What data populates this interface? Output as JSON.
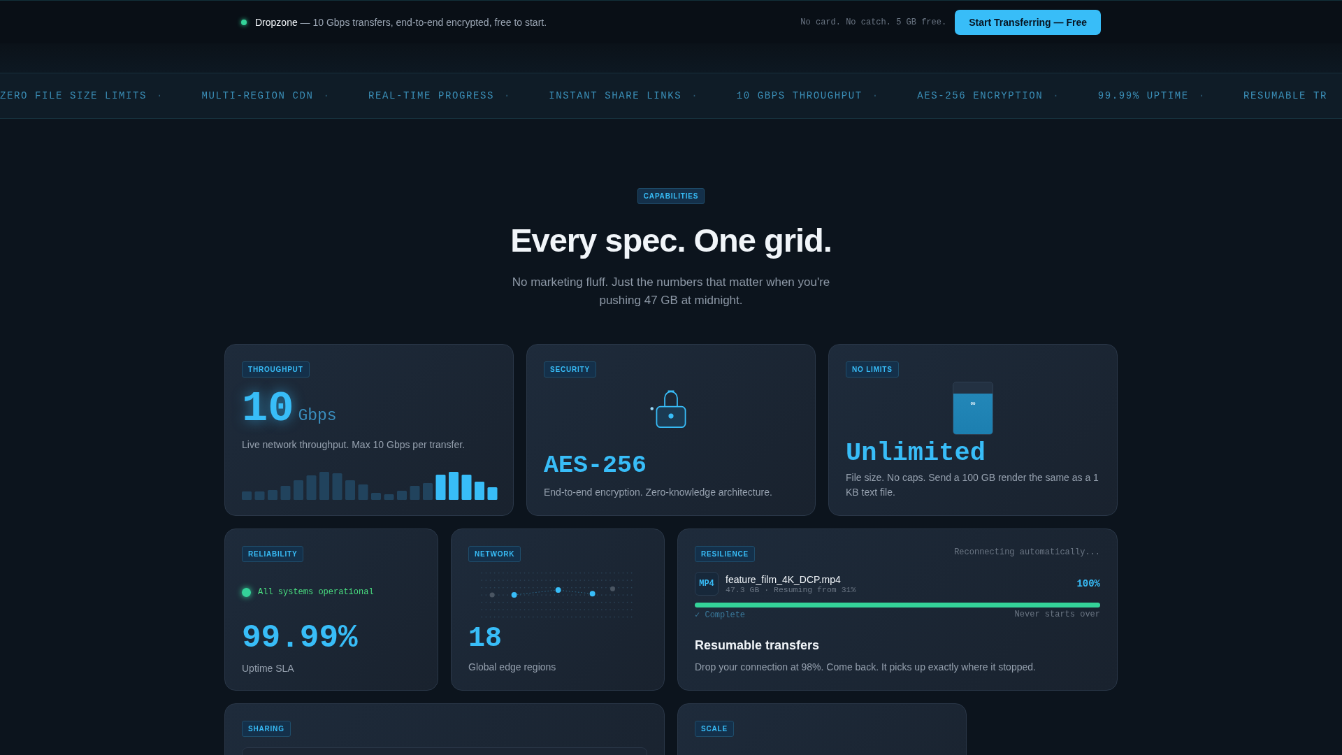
{
  "top_bar": {
    "announcement": "**Dropzone** — 10 Gbps transfers, end-to-end encrypted, free to start.",
    "note": "No card. No catch. 5 GB free.",
    "cta": "Start Transferring — Free"
  },
  "ticker": [
    {
      "label": "ZERO FILE SIZE LIMITS",
      "separator": "·"
    },
    {
      "label": "MULTI-REGION CDN",
      "separator": "·"
    },
    {
      "label": "REAL-TIME PROGRESS",
      "separator": "·"
    },
    {
      "label": "INSTANT SHARE LINKS",
      "separator": "·"
    },
    {
      "label": "10 GBPS THROUGHPUT",
      "separator": "·"
    },
    {
      "label": "AES-256 ENCRYPTION",
      "separator": "·"
    },
    {
      "label": "99.99% UPTIME",
      "separator": "·"
    },
    {
      "label": "RESUMABLE TR"
    }
  ],
  "section": {
    "badge": "CAPABILITIES",
    "heading": "Every spec. One grid.",
    "subtitle": "No marketing fluff. Just the numbers that matter when you're pushing 47 GB at midnight."
  },
  "cards": [
    {
      "kind": "throughput",
      "badge": "THROUGHPUT",
      "value": "10",
      "unit": "Gbps",
      "description": "Live network throughput. Max 10 Gbps per transfer."
    },
    {
      "kind": "security",
      "badge": "SECURITY",
      "value": "AES-256",
      "description": "End-to-end encryption. Zero-knowledge architecture."
    },
    {
      "kind": "limits",
      "badge": "NO LIMITS",
      "symbol": "∞",
      "value": "Unlimited",
      "description": "File size. No caps. Send a 100 GB render the same as a 1 KB text file."
    },
    {
      "kind": "reliability",
      "badge": "RELIABILITY",
      "status": "All systems operational",
      "value": "99.99%",
      "description": "Uptime SLA"
    },
    {
      "kind": "network",
      "badge": "NETWORK",
      "value": "18",
      "description": "Global edge regions"
    },
    {
      "kind": "resilience",
      "badge": "RESILIENCE",
      "status": "Reconnecting automatically...",
      "file": {
        "type": "MP4",
        "name": "feature_film_4K_DCP.mp4",
        "meta": "47.3 GB · Resuming from 31%",
        "percent": "100%",
        "level": 1,
        "state": "✓ Complete",
        "note": "Never starts over"
      },
      "title": "Resumable transfers",
      "description": "Drop your connection at 98%. Come back. It picks up exactly where it stopped."
    },
    {
      "kind": "sharing",
      "badge": "SHARING"
    },
    {
      "kind": "scale",
      "badge": "SCALE"
    }
  ]
}
